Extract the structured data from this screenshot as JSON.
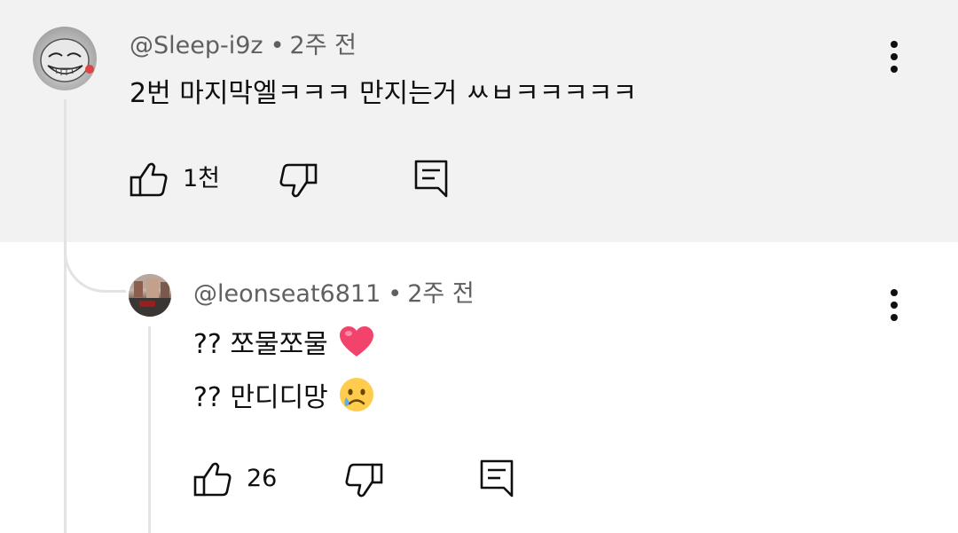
{
  "comments": [
    {
      "author": "@Sleep-i9z",
      "separator": "•",
      "time": "2주 전",
      "text": "2번 마지막엘ㅋㅋㅋ 만지는거 ㅆㅂㅋㅋㅋㅋㅋ",
      "likes": "1천",
      "avatar": "avatar-trollface"
    }
  ],
  "replies": [
    {
      "author": "@leonseat6811",
      "separator": "•",
      "time": "2주 전",
      "lines": [
        "?? 쪼물쪼물",
        "?? 만디디망"
      ],
      "emoji": [
        "pink-heart",
        "crying-face"
      ],
      "likes": "26",
      "avatar": "avatar-photo"
    }
  ],
  "icons": {
    "like": "thumbs-up-icon",
    "dislike": "thumbs-down-icon",
    "reply": "reply-icon",
    "more": "more-vertical-icon"
  },
  "colors": {
    "highlight_bg": "#f2f2f2",
    "meta_text": "#606060",
    "body_text": "#0f0f0f",
    "thread_line": "#e3e3e3"
  }
}
